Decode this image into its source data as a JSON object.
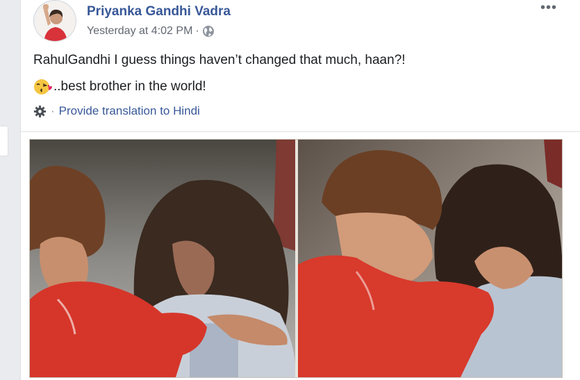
{
  "post": {
    "author": {
      "name": "Priyanka Gandhi Vadra",
      "avatar_alt": "Profile picture of Priyanka Gandhi Vadra"
    },
    "timestamp": "Yesterday at 4:02 PM",
    "meta_separator": "·",
    "privacy_icon": "globe-icon",
    "more_icon": "ellipsis-icon",
    "more_label": "•••",
    "text_line_1": "RahulGandhi I guess things haven’t changed that much, haan?!",
    "emoji": "kissing-face-emoji",
    "text_line_2": "..best brother in the world!",
    "translation": {
      "icon": "gear-icon",
      "separator": "·",
      "link_text": "Provide translation to Hindi"
    },
    "photo": {
      "alt": "Photo of two children"
    }
  },
  "colors": {
    "link_blue": "#385898",
    "text": "#1c1e21",
    "meta_gray": "#616770",
    "background": "#e9ebee"
  }
}
